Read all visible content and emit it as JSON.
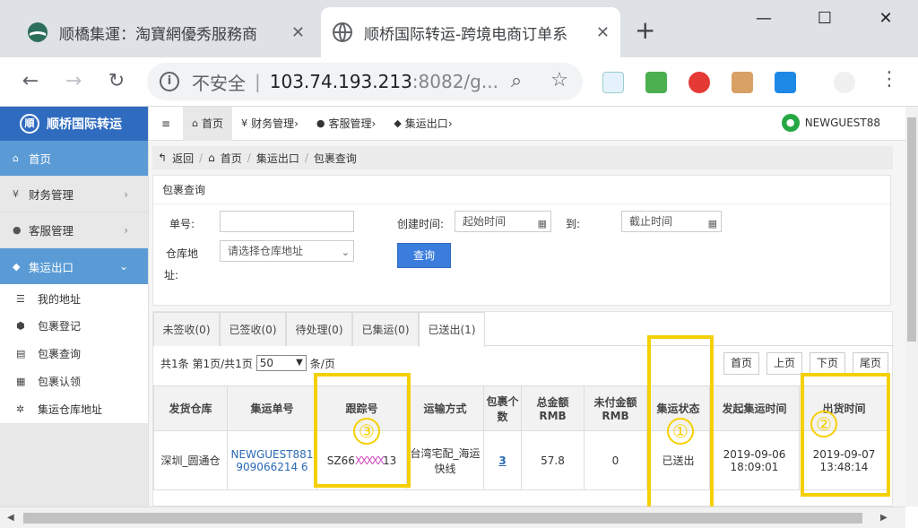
{
  "browser": {
    "tabs": [
      {
        "title": "顺橋集運：淘寶網優秀服務商",
        "active": false
      },
      {
        "title": "顺桥国际转运-跨境电商订单系",
        "active": true
      }
    ],
    "url": {
      "security_label": "不安全",
      "host": "103.74.193.213",
      "rest": ":8082/g..."
    },
    "window_controls": [
      "minimize",
      "maximize",
      "close"
    ]
  },
  "app": {
    "brand": "顺桥国际转运",
    "sidebar": {
      "items": [
        {
          "label": "首页",
          "icon": "home-icon"
        },
        {
          "label": "财务管理",
          "icon": "yen-icon"
        },
        {
          "label": "客服管理",
          "icon": "user-icon"
        },
        {
          "label": "集运出口",
          "icon": "cubes-icon"
        }
      ],
      "subitems": [
        {
          "label": "我的地址",
          "icon": "list-icon"
        },
        {
          "label": "包裹登记",
          "icon": "box-icon"
        },
        {
          "label": "包裹查询",
          "icon": "list-alt-icon"
        },
        {
          "label": "包裹认领",
          "icon": "grid-icon"
        },
        {
          "label": "集运仓库地址",
          "icon": "gear-icon"
        }
      ]
    },
    "topnav": {
      "menu_icon": "≡",
      "items": [
        {
          "label": "首页",
          "icon": "home-icon"
        },
        {
          "label": "财务管理",
          "icon": "yen-icon"
        },
        {
          "label": "客服管理",
          "icon": "user-icon"
        },
        {
          "label": "集运出口",
          "icon": "cubes-icon"
        }
      ],
      "user": "NEWGUEST88"
    },
    "breadcrumb": [
      "返回",
      "首页",
      "集运出口",
      "包裹查询"
    ],
    "search_panel": {
      "title": "包裹查询",
      "order_label": "单号:",
      "warehouse_label": "仓库地",
      "warehouse_label2": "址:",
      "warehouse_placeholder": "请选择仓库地址",
      "created_label": "创建时间:",
      "start_placeholder": "起始时间",
      "to_label": "到:",
      "end_placeholder": "截止时间",
      "query_button": "查询"
    },
    "result_tabs": [
      "未签收(0)",
      "已签收(0)",
      "待处理(0)",
      "已集运(0)",
      "已送出(1)"
    ],
    "active_tab": 4,
    "pagination": {
      "summary_1": "共1条",
      "summary_2": "第1页/共1页",
      "page_size": "50",
      "page_size_unit": "条/页",
      "buttons": [
        "首页",
        "上页",
        "下页",
        "尾页"
      ]
    },
    "table": {
      "headers": [
        "发货仓库",
        "集运单号",
        "跟踪号",
        "运输方式",
        "包裹个数",
        "总金额RMB",
        "未付金额RMB",
        "集运状态",
        "发起集运时间",
        "出货时间"
      ],
      "rows": [
        {
          "warehouse": "深圳_圆通仓",
          "order_no": "NEWGUEST881909066214 6",
          "tracking": "SZ66",
          "tracking_tail": "13",
          "shipping": "台湾宅配_海运快线",
          "pkg_count": "3",
          "total": "57.8",
          "unpaid": "0",
          "status": "已送出",
          "created": "2019-09-06 18:09:01",
          "shipped": "2019-09-07 13:48:14"
        }
      ]
    },
    "annotations": [
      "①",
      "②",
      "③"
    ],
    "highlight_color": "#f5d000"
  }
}
